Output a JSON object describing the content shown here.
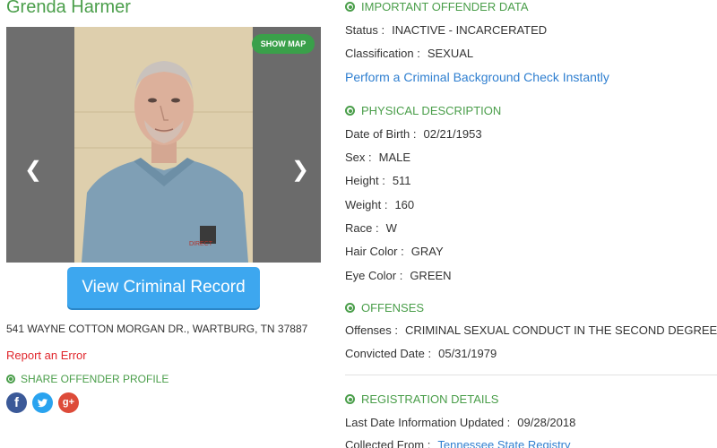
{
  "profile": {
    "name": "Grenda Harmer",
    "show_map": "SHOW MAP",
    "view_button": "View Criminal Record",
    "address": "541 WAYNE COTTON MORGAN DR., WARTBURG, TN 37887",
    "report_error": "Report an Error",
    "share_heading": "SHARE OFFENDER PROFILE",
    "social": {
      "facebook": "f",
      "google_plus": "g+"
    }
  },
  "important": {
    "heading": "IMPORTANT OFFENDER DATA",
    "status_label": "Status :",
    "status_value": "INACTIVE - INCARCERATED",
    "classification_label": "Classification :",
    "classification_value": "SEXUAL",
    "background_link": "Perform a Criminal Background Check Instantly"
  },
  "physical": {
    "heading": "PHYSICAL DESCRIPTION",
    "rows": [
      {
        "label": "Date of Birth :",
        "value": "02/21/1953"
      },
      {
        "label": "Sex :",
        "value": "MALE"
      },
      {
        "label": "Height :",
        "value": "511"
      },
      {
        "label": "Weight :",
        "value": "160"
      },
      {
        "label": "Race :",
        "value": "W"
      },
      {
        "label": "Hair Color :",
        "value": "GRAY"
      },
      {
        "label": "Eye Color :",
        "value": "GREEN"
      }
    ]
  },
  "offenses": {
    "heading": "OFFENSES",
    "offenses_label": "Offenses :",
    "offenses_value": "CRIMINAL SEXUAL CONDUCT IN THE SECOND DEGREE",
    "convicted_label": "Convicted Date :",
    "convicted_value": "05/31/1979"
  },
  "registration": {
    "heading": "REGISTRATION DETAILS",
    "updated_label": "Last Date Information Updated :",
    "updated_value": "09/28/2018",
    "collected_label": "Collected From :",
    "collected_value": "Tennessee State Registry"
  },
  "colors": {
    "accent_green": "#4a9e4a",
    "button_blue": "#3da7ef",
    "link_blue": "#2f7fd0",
    "error_red": "#e0262c"
  }
}
